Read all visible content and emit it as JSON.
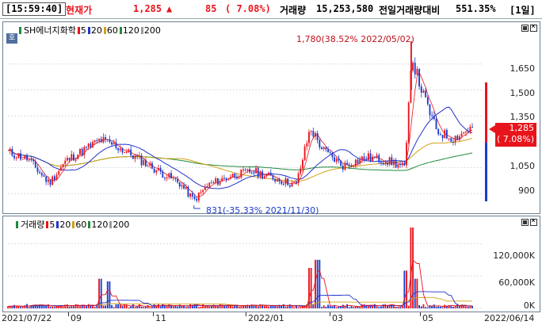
{
  "header": {
    "time": "[15:59:40]",
    "price_label": "현재가",
    "price": "1,285",
    "change_icon": "up-triangle-icon",
    "change_arrow": "▲",
    "change": "85",
    "change_pct": "( 7.08%)",
    "volume_label": "거래량",
    "volume": "15,253,580",
    "prev_volume_label": "전일거래량대비",
    "prev_volume_ratio": "551.35%",
    "period": "[1일]"
  },
  "price_panel": {
    "side_button": "호",
    "legend_title": "SH에너지화학",
    "legend_items": [
      {
        "label": "5",
        "color": "#e8141c"
      },
      {
        "label": "20",
        "color": "#2233cc"
      },
      {
        "label": "60",
        "color": "#d4a017"
      },
      {
        "label": "120",
        "color": "#1f8a3a"
      },
      {
        "label": "200",
        "color": "#9a9a9a"
      }
    ],
    "y_ticks": [
      "1,650",
      "1,500",
      "1,350",
      "1,050",
      "900"
    ],
    "current_price_tag": "1,285",
    "current_change_tag": "( 7.08%)",
    "high_annotation": "1,780(38.52% 2022/05/02)",
    "low_annotation": "831(-35.33% 2021/11/30)"
  },
  "volume_panel": {
    "legend_title": "거래량",
    "legend_items": [
      {
        "label": "5",
        "color": "#e8141c"
      },
      {
        "label": "20",
        "color": "#2233cc"
      },
      {
        "label": "60",
        "color": "#d4a017"
      },
      {
        "label": "120",
        "color": "#1f8a3a"
      },
      {
        "label": "200",
        "color": "#9a9a9a"
      }
    ],
    "y_ticks": [
      "120,000K",
      "60,000K",
      "0K"
    ]
  },
  "x_axis": {
    "labels": [
      "2021/07/22",
      "09",
      "11",
      "2022/01",
      "03",
      "05",
      "2022/06/14"
    ]
  },
  "colors": {
    "up": "#e8141c",
    "down": "#1a3ccc",
    "ma5": "#e8141c",
    "ma20": "#2233cc",
    "ma60": "#d4a017",
    "ma120": "#1f8a3a",
    "ma200": "#9a9a9a"
  },
  "chart_data": {
    "type": "candlestick",
    "title": "SH에너지화학",
    "x_range": [
      "2021/07/22",
      "2022/06/14"
    ],
    "price_ylim": [
      800,
      1800
    ],
    "price_ticks": [
      900,
      1050,
      1350,
      1500,
      1650
    ],
    "price_close_samples": [
      {
        "date": "2021/07/22",
        "close": 1140
      },
      {
        "date": "2021/08/05",
        "close": 1100
      },
      {
        "date": "2021/08/20",
        "close": 960
      },
      {
        "date": "2021/09/01",
        "close": 1090
      },
      {
        "date": "2021/09/15",
        "close": 1160
      },
      {
        "date": "2021/09/25",
        "close": 1210
      },
      {
        "date": "2021/10/05",
        "close": 1180
      },
      {
        "date": "2021/10/20",
        "close": 1110
      },
      {
        "date": "2021/11/05",
        "close": 1030
      },
      {
        "date": "2021/11/20",
        "close": 960
      },
      {
        "date": "2021/11/30",
        "close": 860
      },
      {
        "date": "2021/12/10",
        "close": 950
      },
      {
        "date": "2021/12/25",
        "close": 1000
      },
      {
        "date": "2022/01/10",
        "close": 1030
      },
      {
        "date": "2022/01/25",
        "close": 990
      },
      {
        "date": "2022/02/10",
        "close": 950
      },
      {
        "date": "2022/02/20",
        "close": 1280
      },
      {
        "date": "2022/03/01",
        "close": 1150
      },
      {
        "date": "2022/03/15",
        "close": 1060
      },
      {
        "date": "2022/04/01",
        "close": 1110
      },
      {
        "date": "2022/04/15",
        "close": 1090
      },
      {
        "date": "2022/04/28",
        "close": 1050
      },
      {
        "date": "2022/05/02",
        "close": 1700
      },
      {
        "date": "2022/05/10",
        "close": 1480
      },
      {
        "date": "2022/05/20",
        "close": 1260
      },
      {
        "date": "2022/06/01",
        "close": 1220
      },
      {
        "date": "2022/06/14",
        "close": 1285
      }
    ],
    "high": {
      "value": 1780,
      "pct": 38.52,
      "date": "2022/05/02"
    },
    "low": {
      "value": 831,
      "pct": -35.33,
      "date": "2021/11/30"
    },
    "volume_ylim": [
      0,
      150000
    ],
    "volume_unit": "K",
    "volume_ticks": [
      0,
      60000,
      120000
    ],
    "volume_samples": [
      {
        "date": "2021/09/25",
        "volume": 55000
      },
      {
        "date": "2021/10/01",
        "volume": 50000
      },
      {
        "date": "2022/02/20",
        "volume": 75000
      },
      {
        "date": "2022/02/25",
        "volume": 90000
      },
      {
        "date": "2022/04/28",
        "volume": 70000
      },
      {
        "date": "2022/05/02",
        "volume": 150000
      },
      {
        "date": "2022/05/06",
        "volume": 55000
      }
    ],
    "moving_averages": [
      "5",
      "20",
      "60",
      "120",
      "200"
    ]
  }
}
